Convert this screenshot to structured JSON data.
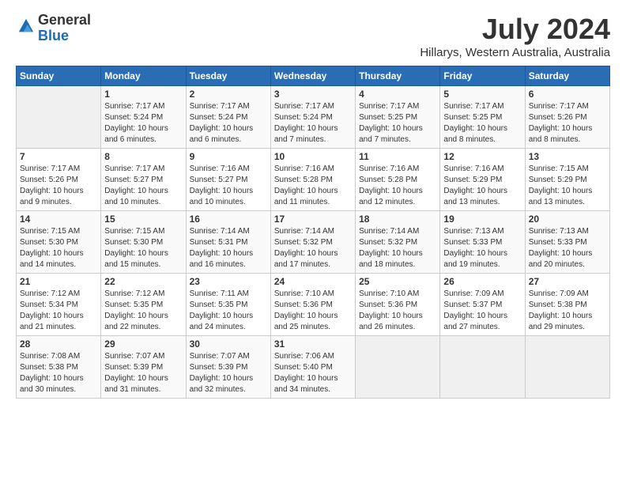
{
  "header": {
    "logo": {
      "line1": "General",
      "line2": "Blue"
    },
    "title": "July 2024",
    "location": "Hillarys, Western Australia, Australia"
  },
  "weekdays": [
    "Sunday",
    "Monday",
    "Tuesday",
    "Wednesday",
    "Thursday",
    "Friday",
    "Saturday"
  ],
  "weeks": [
    [
      {
        "day": "",
        "info": ""
      },
      {
        "day": "1",
        "info": "Sunrise: 7:17 AM\nSunset: 5:24 PM\nDaylight: 10 hours\nand 6 minutes."
      },
      {
        "day": "2",
        "info": "Sunrise: 7:17 AM\nSunset: 5:24 PM\nDaylight: 10 hours\nand 6 minutes."
      },
      {
        "day": "3",
        "info": "Sunrise: 7:17 AM\nSunset: 5:24 PM\nDaylight: 10 hours\nand 7 minutes."
      },
      {
        "day": "4",
        "info": "Sunrise: 7:17 AM\nSunset: 5:25 PM\nDaylight: 10 hours\nand 7 minutes."
      },
      {
        "day": "5",
        "info": "Sunrise: 7:17 AM\nSunset: 5:25 PM\nDaylight: 10 hours\nand 8 minutes."
      },
      {
        "day": "6",
        "info": "Sunrise: 7:17 AM\nSunset: 5:26 PM\nDaylight: 10 hours\nand 8 minutes."
      }
    ],
    [
      {
        "day": "7",
        "info": "Sunrise: 7:17 AM\nSunset: 5:26 PM\nDaylight: 10 hours\nand 9 minutes."
      },
      {
        "day": "8",
        "info": "Sunrise: 7:17 AM\nSunset: 5:27 PM\nDaylight: 10 hours\nand 10 minutes."
      },
      {
        "day": "9",
        "info": "Sunrise: 7:16 AM\nSunset: 5:27 PM\nDaylight: 10 hours\nand 10 minutes."
      },
      {
        "day": "10",
        "info": "Sunrise: 7:16 AM\nSunset: 5:28 PM\nDaylight: 10 hours\nand 11 minutes."
      },
      {
        "day": "11",
        "info": "Sunrise: 7:16 AM\nSunset: 5:28 PM\nDaylight: 10 hours\nand 12 minutes."
      },
      {
        "day": "12",
        "info": "Sunrise: 7:16 AM\nSunset: 5:29 PM\nDaylight: 10 hours\nand 13 minutes."
      },
      {
        "day": "13",
        "info": "Sunrise: 7:15 AM\nSunset: 5:29 PM\nDaylight: 10 hours\nand 13 minutes."
      }
    ],
    [
      {
        "day": "14",
        "info": "Sunrise: 7:15 AM\nSunset: 5:30 PM\nDaylight: 10 hours\nand 14 minutes."
      },
      {
        "day": "15",
        "info": "Sunrise: 7:15 AM\nSunset: 5:30 PM\nDaylight: 10 hours\nand 15 minutes."
      },
      {
        "day": "16",
        "info": "Sunrise: 7:14 AM\nSunset: 5:31 PM\nDaylight: 10 hours\nand 16 minutes."
      },
      {
        "day": "17",
        "info": "Sunrise: 7:14 AM\nSunset: 5:32 PM\nDaylight: 10 hours\nand 17 minutes."
      },
      {
        "day": "18",
        "info": "Sunrise: 7:14 AM\nSunset: 5:32 PM\nDaylight: 10 hours\nand 18 minutes."
      },
      {
        "day": "19",
        "info": "Sunrise: 7:13 AM\nSunset: 5:33 PM\nDaylight: 10 hours\nand 19 minutes."
      },
      {
        "day": "20",
        "info": "Sunrise: 7:13 AM\nSunset: 5:33 PM\nDaylight: 10 hours\nand 20 minutes."
      }
    ],
    [
      {
        "day": "21",
        "info": "Sunrise: 7:12 AM\nSunset: 5:34 PM\nDaylight: 10 hours\nand 21 minutes."
      },
      {
        "day": "22",
        "info": "Sunrise: 7:12 AM\nSunset: 5:35 PM\nDaylight: 10 hours\nand 22 minutes."
      },
      {
        "day": "23",
        "info": "Sunrise: 7:11 AM\nSunset: 5:35 PM\nDaylight: 10 hours\nand 24 minutes."
      },
      {
        "day": "24",
        "info": "Sunrise: 7:10 AM\nSunset: 5:36 PM\nDaylight: 10 hours\nand 25 minutes."
      },
      {
        "day": "25",
        "info": "Sunrise: 7:10 AM\nSunset: 5:36 PM\nDaylight: 10 hours\nand 26 minutes."
      },
      {
        "day": "26",
        "info": "Sunrise: 7:09 AM\nSunset: 5:37 PM\nDaylight: 10 hours\nand 27 minutes."
      },
      {
        "day": "27",
        "info": "Sunrise: 7:09 AM\nSunset: 5:38 PM\nDaylight: 10 hours\nand 29 minutes."
      }
    ],
    [
      {
        "day": "28",
        "info": "Sunrise: 7:08 AM\nSunset: 5:38 PM\nDaylight: 10 hours\nand 30 minutes."
      },
      {
        "day": "29",
        "info": "Sunrise: 7:07 AM\nSunset: 5:39 PM\nDaylight: 10 hours\nand 31 minutes."
      },
      {
        "day": "30",
        "info": "Sunrise: 7:07 AM\nSunset: 5:39 PM\nDaylight: 10 hours\nand 32 minutes."
      },
      {
        "day": "31",
        "info": "Sunrise: 7:06 AM\nSunset: 5:40 PM\nDaylight: 10 hours\nand 34 minutes."
      },
      {
        "day": "",
        "info": ""
      },
      {
        "day": "",
        "info": ""
      },
      {
        "day": "",
        "info": ""
      }
    ]
  ]
}
